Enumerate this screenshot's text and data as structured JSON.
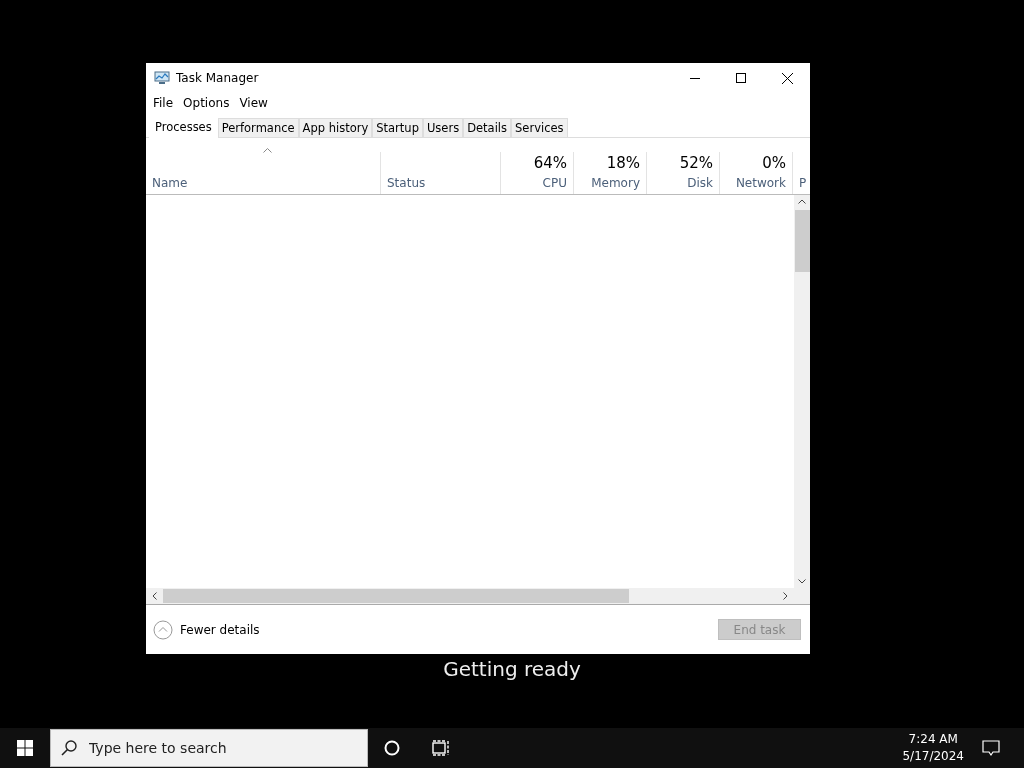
{
  "desktop": {
    "status_text": "Getting ready"
  },
  "window": {
    "title": "Task Manager",
    "menu": [
      "File",
      "Options",
      "View"
    ],
    "tabs": [
      {
        "label": "Processes",
        "selected": true
      },
      {
        "label": "Performance",
        "selected": false
      },
      {
        "label": "App history",
        "selected": false
      },
      {
        "label": "Startup",
        "selected": false
      },
      {
        "label": "Users",
        "selected": false
      },
      {
        "label": "Details",
        "selected": false
      },
      {
        "label": "Services",
        "selected": false
      }
    ],
    "columns": [
      {
        "label": "Name",
        "sorted": true
      },
      {
        "label": "Status",
        "sorted": false
      },
      {
        "label": "CPU",
        "usage": "64%",
        "sorted": false
      },
      {
        "label": "Memory",
        "usage": "18%",
        "sorted": false
      },
      {
        "label": "Disk",
        "usage": "52%",
        "sorted": false
      },
      {
        "label": "Network",
        "usage": "0%",
        "sorted": false
      },
      {
        "label": "P",
        "sorted": false
      }
    ],
    "footer": {
      "toggle": "Fewer details",
      "button": {
        "label": "End task",
        "disabled": true
      }
    }
  },
  "taskbar": {
    "search": {
      "placeholder": "Type here to search"
    },
    "time": "7:24 AM",
    "date": "5/17/2024"
  }
}
